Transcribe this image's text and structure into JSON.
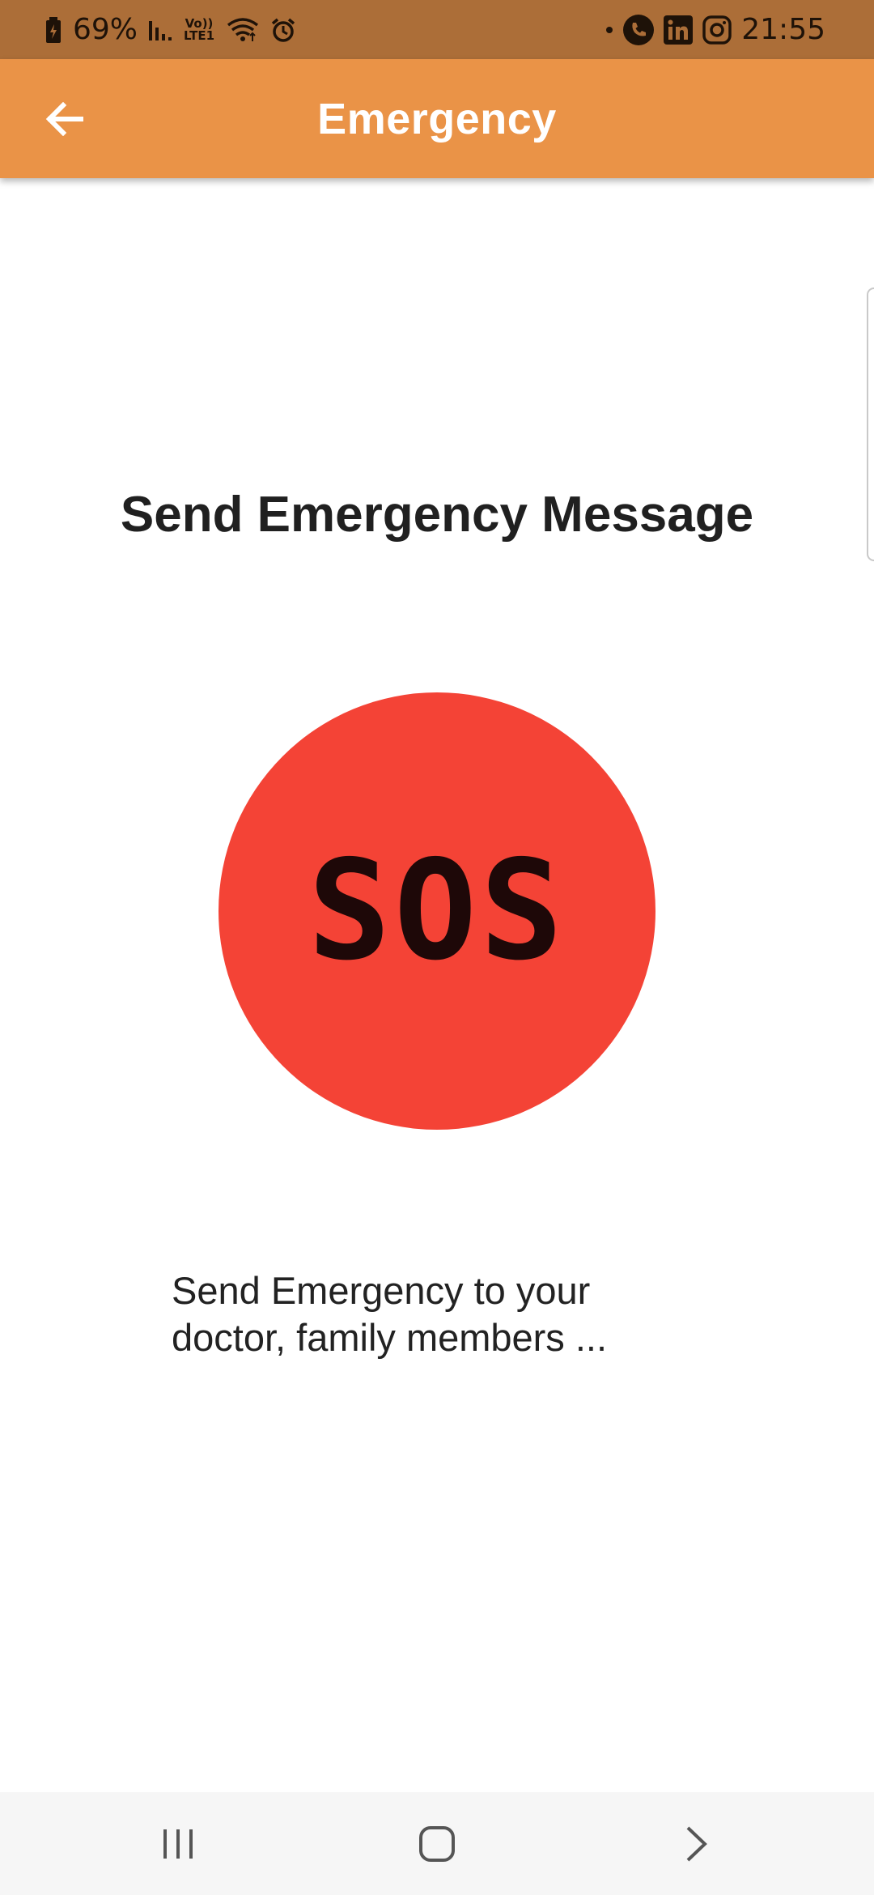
{
  "status_bar": {
    "battery": "69%",
    "volte_top": "Vo))",
    "volte_bottom": "LTE1",
    "time": "21:55",
    "icons_left": [
      "battery-charging-icon",
      "signal-icon",
      "volte-icon",
      "wifi-icon",
      "alarm-icon"
    ],
    "icons_right": [
      "notification-dot-icon",
      "phone-icon",
      "linkedin-icon",
      "instagram-icon"
    ]
  },
  "app_bar": {
    "title": "Emergency",
    "back_icon": "arrow-left-icon"
  },
  "main": {
    "heading": "Send Emergency Message",
    "sos_label": "SOS",
    "description": "Send Emergency to your doctor, family members ..."
  },
  "nav_bar": {
    "icons": [
      "recent-apps-icon",
      "home-icon",
      "back-icon"
    ]
  },
  "colors": {
    "status_bar": "#ac6e38",
    "app_bar": "#ea9347",
    "sos": "#f44336",
    "sos_text": "#1e0808"
  }
}
